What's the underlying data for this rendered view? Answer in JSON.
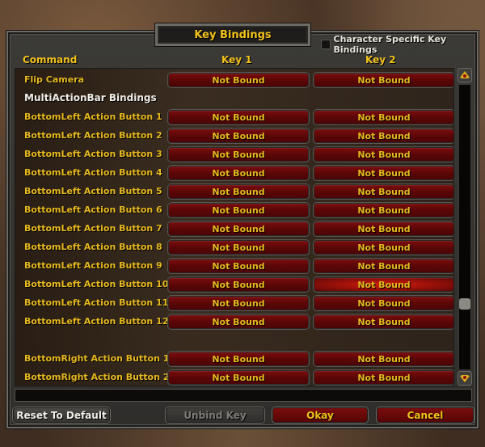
{
  "window": {
    "title": "Key Bindings",
    "character_specific_label": "Character Specific Key Bindings",
    "character_specific_checked": false
  },
  "columns": {
    "command": "Command",
    "key1": "Key 1",
    "key2": "Key 2"
  },
  "rows": [
    {
      "type": "binding",
      "command": "Flip Camera",
      "key1": "Not Bound",
      "key2": "Not Bound"
    },
    {
      "type": "header",
      "command": "MultiActionBar Bindings"
    },
    {
      "type": "binding",
      "command": "BottomLeft Action Button 1",
      "key1": "Not Bound",
      "key2": "Not Bound"
    },
    {
      "type": "binding",
      "command": "BottomLeft Action Button 2",
      "key1": "Not Bound",
      "key2": "Not Bound"
    },
    {
      "type": "binding",
      "command": "BottomLeft Action Button 3",
      "key1": "Not Bound",
      "key2": "Not Bound"
    },
    {
      "type": "binding",
      "command": "BottomLeft Action Button 4",
      "key1": "Not Bound",
      "key2": "Not Bound"
    },
    {
      "type": "binding",
      "command": "BottomLeft Action Button 5",
      "key1": "Not Bound",
      "key2": "Not Bound"
    },
    {
      "type": "binding",
      "command": "BottomLeft Action Button 6",
      "key1": "Not Bound",
      "key2": "Not Bound"
    },
    {
      "type": "binding",
      "command": "BottomLeft Action Button 7",
      "key1": "Not Bound",
      "key2": "Not Bound"
    },
    {
      "type": "binding",
      "command": "BottomLeft Action Button 8",
      "key1": "Not Bound",
      "key2": "Not Bound"
    },
    {
      "type": "binding",
      "command": "BottomLeft Action Button 9",
      "key1": "Not Bound",
      "key2": "Not Bound"
    },
    {
      "type": "binding",
      "command": "BottomLeft Action Button 10",
      "key1": "Not Bound",
      "key2": "Not Bound",
      "key2_highlighted": true
    },
    {
      "type": "binding",
      "command": "BottomLeft Action Button 11",
      "key1": "Not Bound",
      "key2": "Not Bound"
    },
    {
      "type": "binding",
      "command": "BottomLeft Action Button 12",
      "key1": "Not Bound",
      "key2": "Not Bound"
    },
    {
      "type": "spacer"
    },
    {
      "type": "binding",
      "command": "BottomRight Action Button 1",
      "key1": "Not Bound",
      "key2": "Not Bound"
    },
    {
      "type": "binding",
      "command": "BottomRight Action Button 2",
      "key1": "Not Bound",
      "key2": "Not Bound"
    }
  ],
  "scrollbar": {
    "position_fraction": 0.78
  },
  "buttons": {
    "reset": "Reset To Default",
    "unbind": "Unbind Key",
    "okay": "Okay",
    "cancel": "Cancel"
  },
  "colors": {
    "gold_text": "#f2c21a",
    "command_text": "#e6b81e",
    "key_button_red": "#5c0707",
    "key_button_highlight": "#d2230f"
  }
}
